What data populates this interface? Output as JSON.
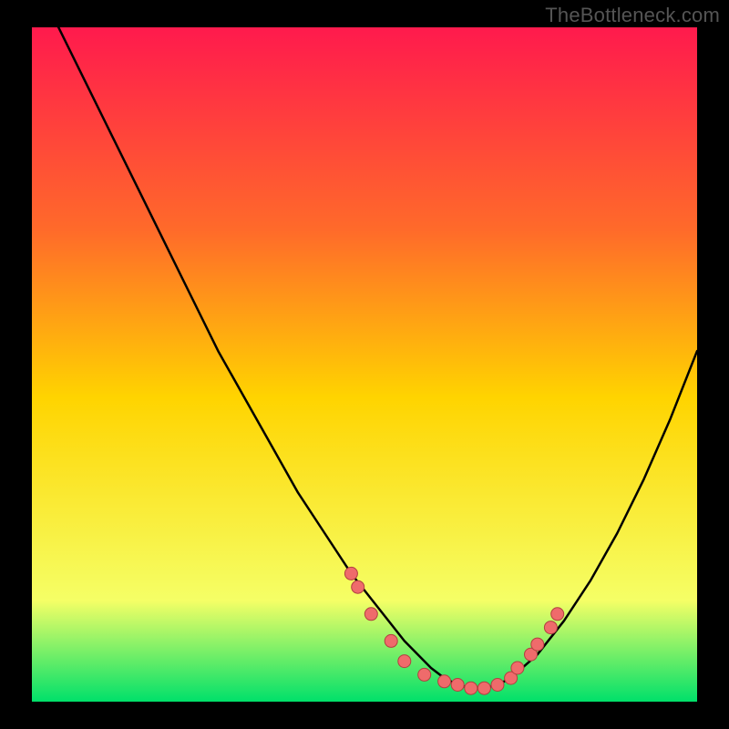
{
  "watermark": "TheBottleneck.com",
  "colors": {
    "background": "#000000",
    "gradient_top": "#ff1a4d",
    "gradient_mid_upper": "#ff6a2a",
    "gradient_mid": "#ffd400",
    "gradient_mid_lower": "#f5ff66",
    "gradient_bottom": "#00e06a",
    "curve": "#000000",
    "dot_fill": "#ef6b6b",
    "dot_stroke": "#b24040"
  },
  "chart_data": {
    "type": "line",
    "title": "",
    "xlabel": "",
    "ylabel": "",
    "xlim": [
      0,
      100
    ],
    "ylim": [
      0,
      100
    ],
    "series": [
      {
        "name": "bottleneck-curve",
        "x": [
          0,
          4,
          8,
          12,
          16,
          20,
          24,
          28,
          32,
          36,
          40,
          44,
          48,
          52,
          56,
          60,
          62,
          64,
          66,
          68,
          70,
          72,
          76,
          80,
          84,
          88,
          92,
          96,
          100
        ],
        "y": [
          105,
          100,
          92,
          84,
          76,
          68,
          60,
          52,
          45,
          38,
          31,
          25,
          19,
          14,
          9,
          5,
          3.5,
          2.5,
          2,
          2,
          2.5,
          3.5,
          7,
          12,
          18,
          25,
          33,
          42,
          52
        ]
      }
    ],
    "dots": {
      "name": "highlight-dots",
      "x": [
        48,
        49,
        51,
        54,
        56,
        59,
        62,
        64,
        66,
        68,
        70,
        72,
        73,
        75,
        76,
        78,
        79
      ],
      "y": [
        19,
        17,
        13,
        9,
        6,
        4,
        3,
        2.5,
        2,
        2,
        2.5,
        3.5,
        5,
        7,
        8.5,
        11,
        13
      ]
    }
  }
}
